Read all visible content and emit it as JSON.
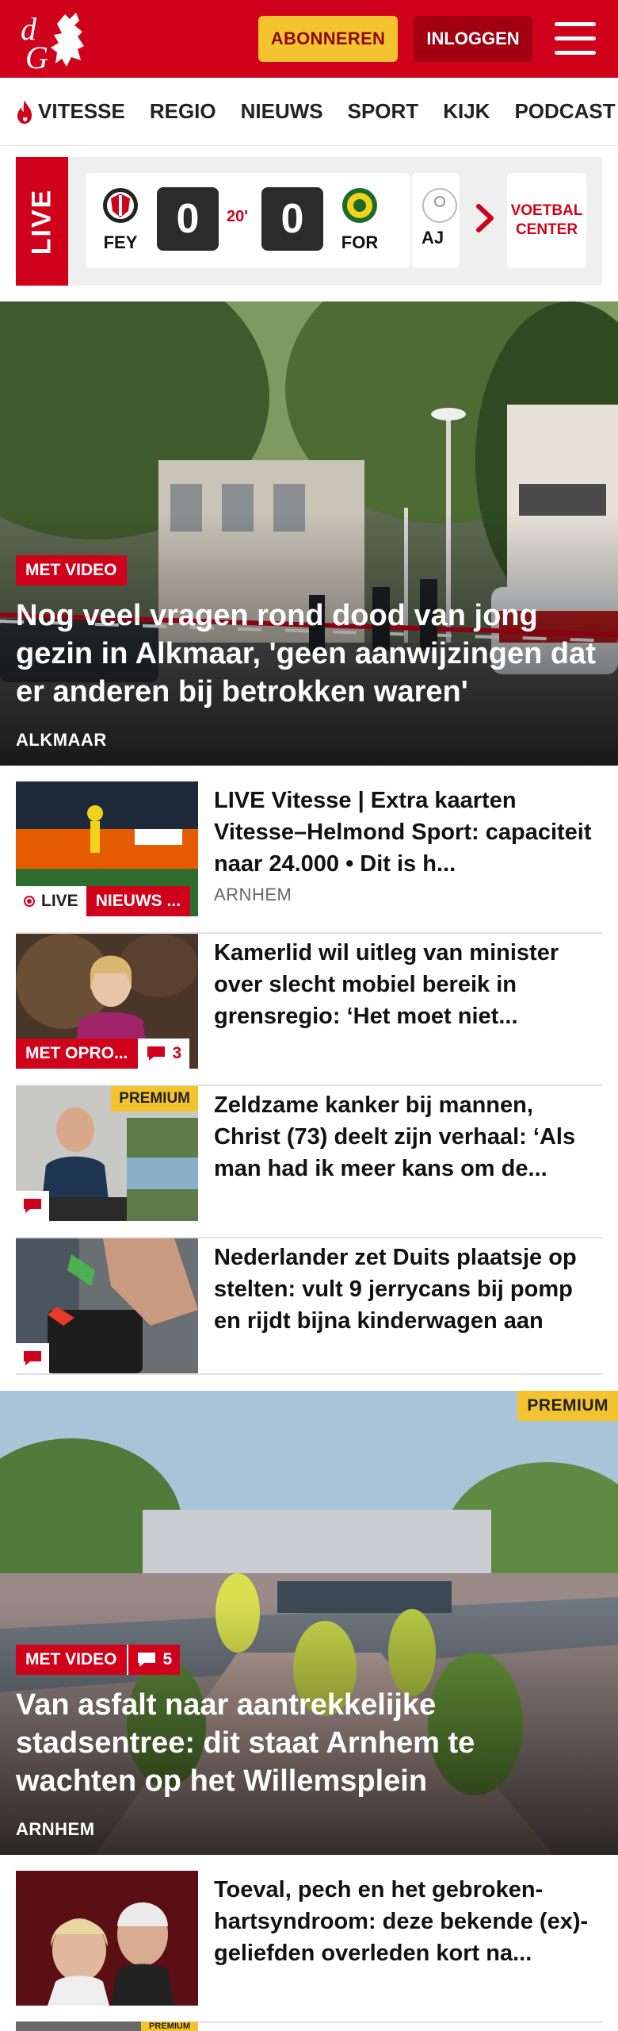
{
  "header": {
    "logo_text": "dG",
    "subscribe_label": "ABONNEREN",
    "login_label": "INLOGGEN",
    "brand_color": "#d0021b"
  },
  "nav": {
    "items": [
      {
        "label": "VITESSE",
        "icon": "flame-icon"
      },
      {
        "label": "REGIO"
      },
      {
        "label": "NIEUWS"
      },
      {
        "label": "SPORT"
      },
      {
        "label": "KIJK"
      },
      {
        "label": "PODCAST"
      }
    ]
  },
  "live": {
    "tab_label": "LIVE",
    "match": {
      "home": "FEY",
      "away": "FOR",
      "home_score": "0",
      "away_score": "0",
      "minute": "20'"
    },
    "next_team": "AJ",
    "voetbal_center_label": "VOETBAL CENTER"
  },
  "hero1": {
    "badge": "MET VIDEO",
    "title": "Nog veel vragen rond dood van jong gezin in Alkmaar, 'geen aanwijzingen dat er anderen bij betrokken waren'",
    "location": "ALKMAAR"
  },
  "articles": [
    {
      "title": "LIVE Vitesse | Extra kaarten Vitesse–Helmond Sport: capaciteit naar 24.000 • Dit is h...",
      "location": "ARNHEM",
      "badge_live": "LIVE",
      "badge_section": "NIEUWS ..."
    },
    {
      "title": "Kamerlid wil uitleg van minister over slecht mobiel bereik in grensregio: ‘Het moet niet...",
      "badge": "MET OPRO...",
      "comments": "3"
    },
    {
      "title": "Zeldzame kanker bij mannen, Christ (73) deelt zijn verhaal: ‘Als man had ik meer kans om de...",
      "premium": "PREMIUM"
    },
    {
      "title": "Nederlander zet Duits plaatsje op stelten: vult 9 jerrycans bij pomp en rijdt bijna kinderwagen aan"
    }
  ],
  "hero2": {
    "premium": "PREMIUM",
    "badge": "MET VIDEO",
    "comments": "5",
    "title": "Van asfalt naar aantrekkelijke stadsentree: dit staat Arnhem te wachten op het Willemsplein",
    "location": "ARNHEM"
  },
  "articles2": [
    {
      "title": "Toeval, pech en het gebroken-hartsyndroom: deze bekende (ex)-geliefden overleden kort na..."
    },
    {
      "premium": "PREMIUM"
    }
  ]
}
